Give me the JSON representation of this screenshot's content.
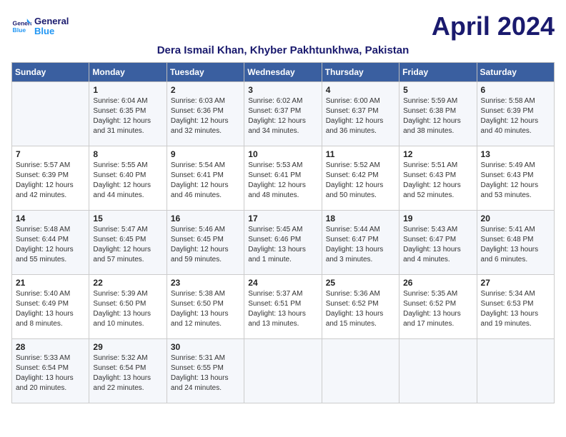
{
  "logo": {
    "line1": "General",
    "line2": "Blue"
  },
  "title": "April 2024",
  "location": "Dera Ismail Khan, Khyber Pakhtunkhwa, Pakistan",
  "headers": [
    "Sunday",
    "Monday",
    "Tuesday",
    "Wednesday",
    "Thursday",
    "Friday",
    "Saturday"
  ],
  "weeks": [
    [
      {
        "day": "",
        "sunrise": "",
        "sunset": "",
        "daylight": ""
      },
      {
        "day": "1",
        "sunrise": "Sunrise: 6:04 AM",
        "sunset": "Sunset: 6:35 PM",
        "daylight": "Daylight: 12 hours and 31 minutes."
      },
      {
        "day": "2",
        "sunrise": "Sunrise: 6:03 AM",
        "sunset": "Sunset: 6:36 PM",
        "daylight": "Daylight: 12 hours and 32 minutes."
      },
      {
        "day": "3",
        "sunrise": "Sunrise: 6:02 AM",
        "sunset": "Sunset: 6:37 PM",
        "daylight": "Daylight: 12 hours and 34 minutes."
      },
      {
        "day": "4",
        "sunrise": "Sunrise: 6:00 AM",
        "sunset": "Sunset: 6:37 PM",
        "daylight": "Daylight: 12 hours and 36 minutes."
      },
      {
        "day": "5",
        "sunrise": "Sunrise: 5:59 AM",
        "sunset": "Sunset: 6:38 PM",
        "daylight": "Daylight: 12 hours and 38 minutes."
      },
      {
        "day": "6",
        "sunrise": "Sunrise: 5:58 AM",
        "sunset": "Sunset: 6:39 PM",
        "daylight": "Daylight: 12 hours and 40 minutes."
      }
    ],
    [
      {
        "day": "7",
        "sunrise": "Sunrise: 5:57 AM",
        "sunset": "Sunset: 6:39 PM",
        "daylight": "Daylight: 12 hours and 42 minutes."
      },
      {
        "day": "8",
        "sunrise": "Sunrise: 5:55 AM",
        "sunset": "Sunset: 6:40 PM",
        "daylight": "Daylight: 12 hours and 44 minutes."
      },
      {
        "day": "9",
        "sunrise": "Sunrise: 5:54 AM",
        "sunset": "Sunset: 6:41 PM",
        "daylight": "Daylight: 12 hours and 46 minutes."
      },
      {
        "day": "10",
        "sunrise": "Sunrise: 5:53 AM",
        "sunset": "Sunset: 6:41 PM",
        "daylight": "Daylight: 12 hours and 48 minutes."
      },
      {
        "day": "11",
        "sunrise": "Sunrise: 5:52 AM",
        "sunset": "Sunset: 6:42 PM",
        "daylight": "Daylight: 12 hours and 50 minutes."
      },
      {
        "day": "12",
        "sunrise": "Sunrise: 5:51 AM",
        "sunset": "Sunset: 6:43 PM",
        "daylight": "Daylight: 12 hours and 52 minutes."
      },
      {
        "day": "13",
        "sunrise": "Sunrise: 5:49 AM",
        "sunset": "Sunset: 6:43 PM",
        "daylight": "Daylight: 12 hours and 53 minutes."
      }
    ],
    [
      {
        "day": "14",
        "sunrise": "Sunrise: 5:48 AM",
        "sunset": "Sunset: 6:44 PM",
        "daylight": "Daylight: 12 hours and 55 minutes."
      },
      {
        "day": "15",
        "sunrise": "Sunrise: 5:47 AM",
        "sunset": "Sunset: 6:45 PM",
        "daylight": "Daylight: 12 hours and 57 minutes."
      },
      {
        "day": "16",
        "sunrise": "Sunrise: 5:46 AM",
        "sunset": "Sunset: 6:45 PM",
        "daylight": "Daylight: 12 hours and 59 minutes."
      },
      {
        "day": "17",
        "sunrise": "Sunrise: 5:45 AM",
        "sunset": "Sunset: 6:46 PM",
        "daylight": "Daylight: 13 hours and 1 minute."
      },
      {
        "day": "18",
        "sunrise": "Sunrise: 5:44 AM",
        "sunset": "Sunset: 6:47 PM",
        "daylight": "Daylight: 13 hours and 3 minutes."
      },
      {
        "day": "19",
        "sunrise": "Sunrise: 5:43 AM",
        "sunset": "Sunset: 6:47 PM",
        "daylight": "Daylight: 13 hours and 4 minutes."
      },
      {
        "day": "20",
        "sunrise": "Sunrise: 5:41 AM",
        "sunset": "Sunset: 6:48 PM",
        "daylight": "Daylight: 13 hours and 6 minutes."
      }
    ],
    [
      {
        "day": "21",
        "sunrise": "Sunrise: 5:40 AM",
        "sunset": "Sunset: 6:49 PM",
        "daylight": "Daylight: 13 hours and 8 minutes."
      },
      {
        "day": "22",
        "sunrise": "Sunrise: 5:39 AM",
        "sunset": "Sunset: 6:50 PM",
        "daylight": "Daylight: 13 hours and 10 minutes."
      },
      {
        "day": "23",
        "sunrise": "Sunrise: 5:38 AM",
        "sunset": "Sunset: 6:50 PM",
        "daylight": "Daylight: 13 hours and 12 minutes."
      },
      {
        "day": "24",
        "sunrise": "Sunrise: 5:37 AM",
        "sunset": "Sunset: 6:51 PM",
        "daylight": "Daylight: 13 hours and 13 minutes."
      },
      {
        "day": "25",
        "sunrise": "Sunrise: 5:36 AM",
        "sunset": "Sunset: 6:52 PM",
        "daylight": "Daylight: 13 hours and 15 minutes."
      },
      {
        "day": "26",
        "sunrise": "Sunrise: 5:35 AM",
        "sunset": "Sunset: 6:52 PM",
        "daylight": "Daylight: 13 hours and 17 minutes."
      },
      {
        "day": "27",
        "sunrise": "Sunrise: 5:34 AM",
        "sunset": "Sunset: 6:53 PM",
        "daylight": "Daylight: 13 hours and 19 minutes."
      }
    ],
    [
      {
        "day": "28",
        "sunrise": "Sunrise: 5:33 AM",
        "sunset": "Sunset: 6:54 PM",
        "daylight": "Daylight: 13 hours and 20 minutes."
      },
      {
        "day": "29",
        "sunrise": "Sunrise: 5:32 AM",
        "sunset": "Sunset: 6:54 PM",
        "daylight": "Daylight: 13 hours and 22 minutes."
      },
      {
        "day": "30",
        "sunrise": "Sunrise: 5:31 AM",
        "sunset": "Sunset: 6:55 PM",
        "daylight": "Daylight: 13 hours and 24 minutes."
      },
      {
        "day": "",
        "sunrise": "",
        "sunset": "",
        "daylight": ""
      },
      {
        "day": "",
        "sunrise": "",
        "sunset": "",
        "daylight": ""
      },
      {
        "day": "",
        "sunrise": "",
        "sunset": "",
        "daylight": ""
      },
      {
        "day": "",
        "sunrise": "",
        "sunset": "",
        "daylight": ""
      }
    ]
  ]
}
